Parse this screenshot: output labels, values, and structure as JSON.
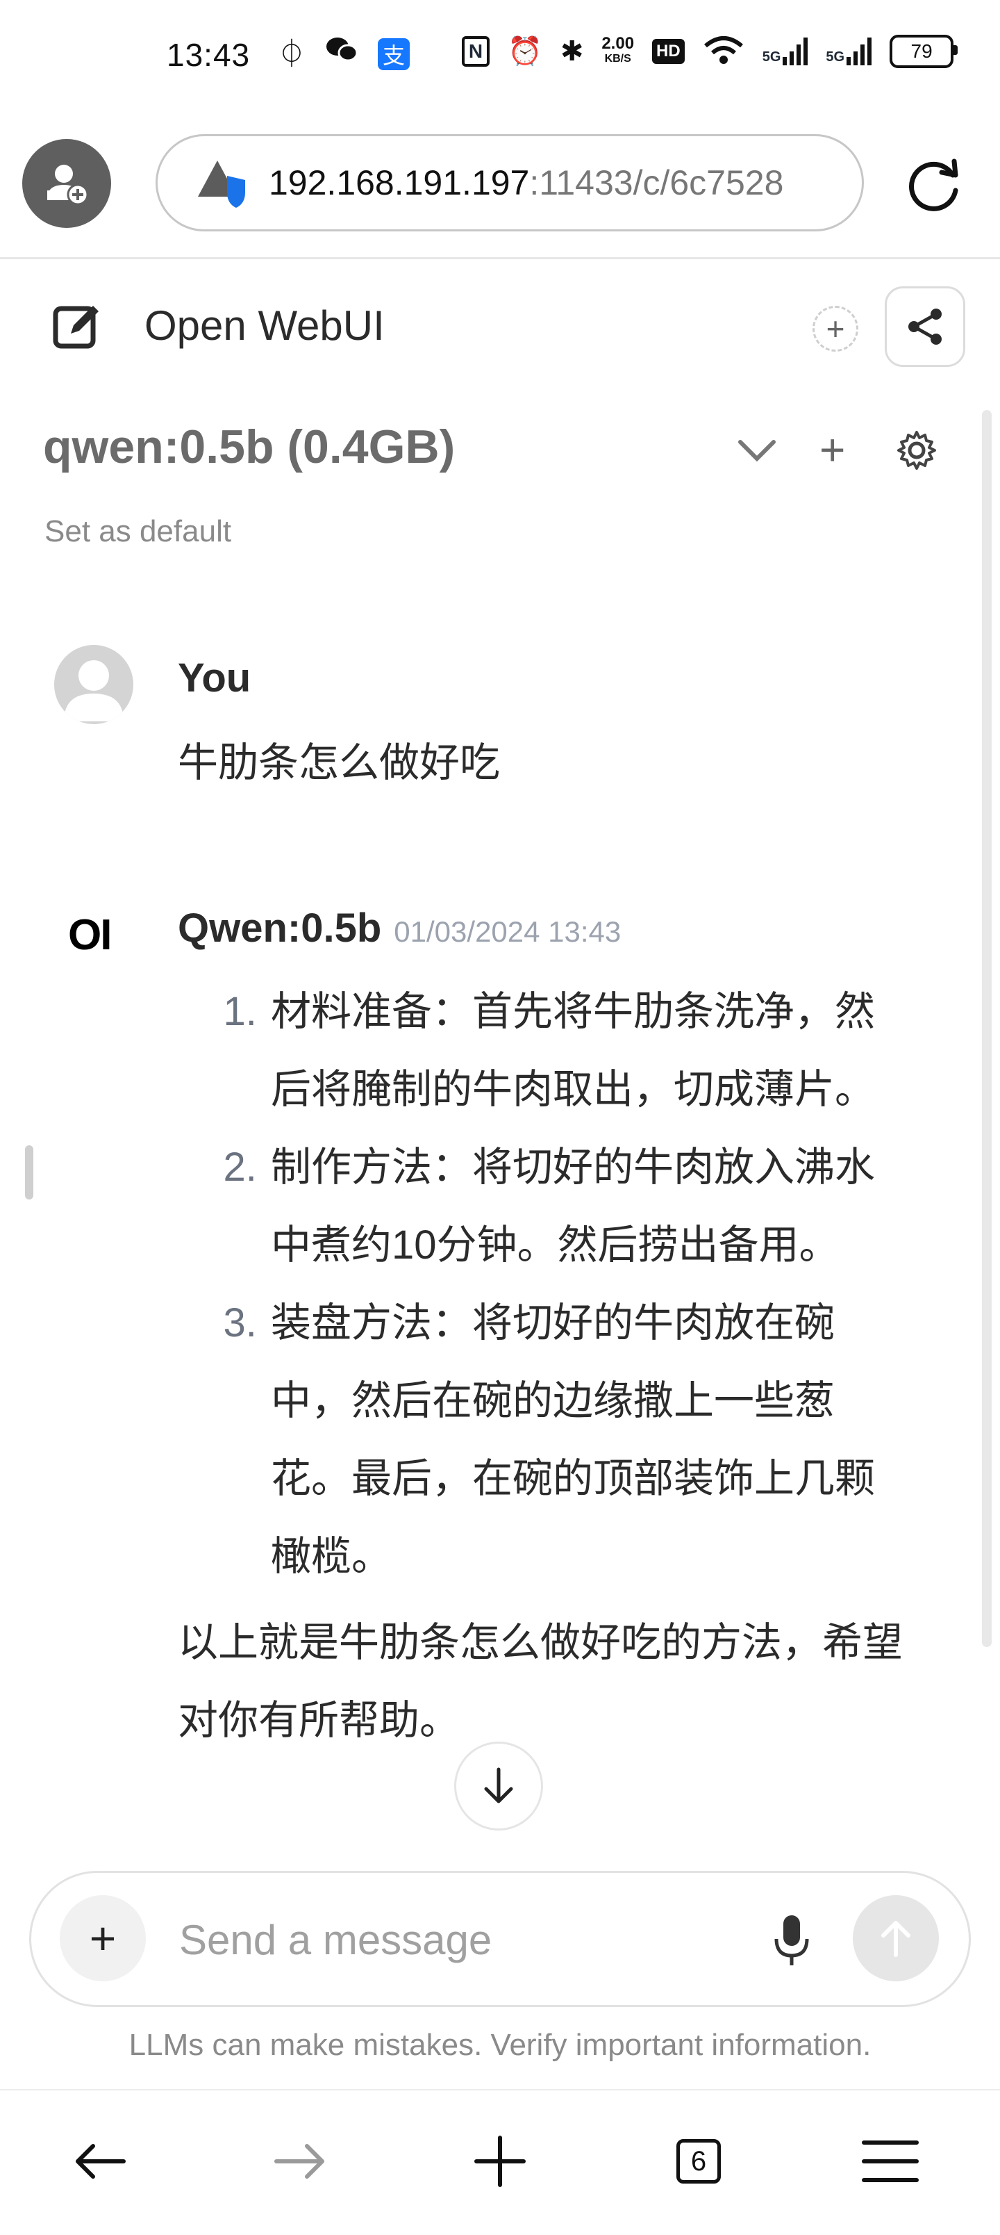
{
  "status_bar": {
    "time": "13:43",
    "speed_value": "2.00",
    "speed_unit": "KB/S",
    "battery": "79",
    "network_1": "5G",
    "network_2": "5G",
    "hd_label": "HD"
  },
  "browser": {
    "url_host": "192.168.191.197",
    "url_path": ":11433/c/6c7528"
  },
  "header": {
    "title": "Open WebUI"
  },
  "model": {
    "name": "qwen:0.5b (0.4GB)",
    "set_default": "Set as default"
  },
  "messages": {
    "user": {
      "name": "You",
      "text": "牛肋条怎么做好吃"
    },
    "assistant": {
      "logo": "OI",
      "name": "Qwen:0.5b",
      "timestamp": "01/03/2024 13:43",
      "items": [
        "材料准备：首先将牛肋条洗净，然后将腌制的牛肉取出，切成薄片。",
        "制作方法：将切好的牛肉放入沸水中煮约10分钟。然后捞出备用。",
        "装盘方法：将切好的牛肉放在碗中，然后在碗的边缘撒上一些葱花。最后，在碗的顶部装饰上几颗橄榄。"
      ],
      "closing": "以上就是牛肋条怎么做好吃的方法，希望对你有所帮助。"
    }
  },
  "input": {
    "placeholder": "Send a message",
    "value": ""
  },
  "disclaimer": "LLMs can make mistakes. Verify important information.",
  "bottom_nav": {
    "tab_count": "6"
  },
  "colors": {
    "avatar_bg": "#5f5f5f",
    "shield_blue": "#1a73e8",
    "send_disabled": "#e6e6e6"
  }
}
